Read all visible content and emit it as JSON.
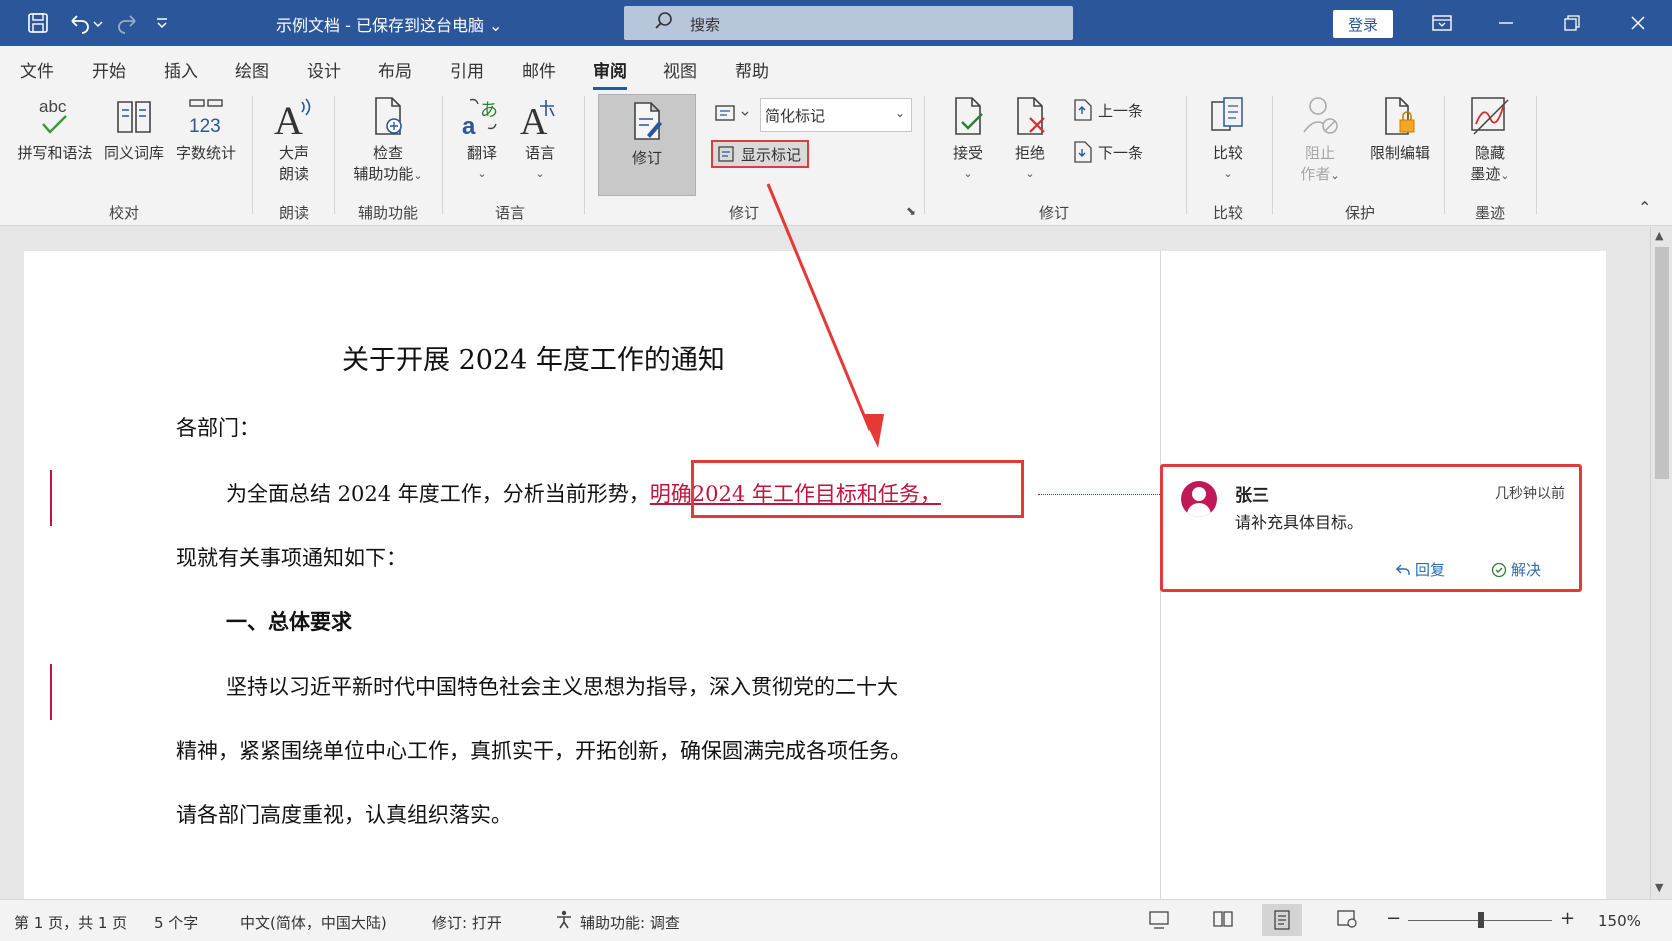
{
  "titlebar": {
    "doc_title": "示例文档 - 已保存到这台电脑 ⌄",
    "search_placeholder": "搜索",
    "login_label": "登录"
  },
  "menu": {
    "tabs": [
      "文件",
      "开始",
      "插入",
      "绘图",
      "设计",
      "布局",
      "引用",
      "邮件",
      "审阅",
      "视图",
      "帮助"
    ],
    "active": "审阅"
  },
  "ribbon": {
    "groups": {
      "proofing": "校对",
      "speech": "朗读",
      "accessibility": "辅助功能",
      "language": "语言",
      "tracking": "修订",
      "changes": "修订",
      "compare": "比较",
      "protect": "保护",
      "ink": "墨迹"
    },
    "buttons": {
      "spelling": "拼写和语法",
      "thesaurus": "同义词库",
      "word_count": "字数统计",
      "read_aloud_1": "大声",
      "read_aloud_2": "朗读",
      "check_1": "检查",
      "check_2": "辅助功能",
      "translate": "翻译",
      "language": "语言",
      "track_changes": "修订",
      "markup_mode": "简化标记",
      "show_markup": "显示标记",
      "accept": "接受",
      "reject": "拒绝",
      "previous": "上一条",
      "next": "下一条",
      "compare": "比较",
      "block_1": "阻止",
      "block_2": "作者",
      "restrict": "限制编辑",
      "hide_ink_1": "隐藏",
      "hide_ink_2": "墨迹"
    }
  },
  "document": {
    "title": "关于开展 2024 年度工作的通知",
    "salutation": "各部门：",
    "p1_start": "为全面总结 2024 年度工作，分析当前形势，",
    "p1_insert": "明确2024 年工作目标和任务，",
    "p1_end": "现就有关事项通知如下：",
    "heading1": "一、总体要求",
    "p2_line1": "坚持以习近平新时代中国特色社会主义思想为指导，深入贯彻党的二十大",
    "p2_line2": "精神，紧紧围绕单位中心工作，真抓实干，开拓创新，确保圆满完成各项任务。",
    "p2_line3": "请各部门高度重视，认真组织落实。"
  },
  "comment": {
    "author": "张三",
    "time": "几秒钟以前",
    "text": "请补充具体目标。",
    "reply": "回复",
    "resolve": "解决"
  },
  "statusbar": {
    "page": "第 1 页，共 1 页",
    "words": "5 个字",
    "language": "中文(简体，中国大陆)",
    "track": "修订: 打开",
    "accessibility": "辅助功能: 调查",
    "zoom": "150%"
  },
  "colors": {
    "title_bar": "#2b579a",
    "revision": "#c0143c",
    "annotation": "#e03a3a"
  }
}
